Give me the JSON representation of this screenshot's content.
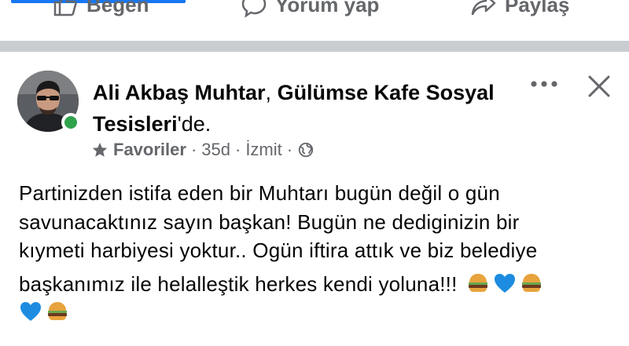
{
  "actions": {
    "like_label": "Beğen",
    "comment_label": "Yorum yap",
    "share_label": "Paylaş"
  },
  "post": {
    "author": "Ali Akbaş Muhtar",
    "connector": ", ",
    "location": "Gülümse Kafe Sosyal Tesisleri",
    "location_suffix": "'de.",
    "meta": {
      "favorites_label": "Favoriler",
      "dot1": "·",
      "time": "35d",
      "dot2": "·",
      "place": "İzmit",
      "dot3": "·"
    },
    "body_lines": [
      "Partinizden istifa eden bir Muhtarı bugün değil o gün",
      "savunacaktınız sayın başkan! Bugün ne dediginizin bir",
      "kıymeti harbiyesi yoktur.. Ogün iftira attık ve biz belediye",
      "başkanımız ile helalleştik herkes kendi yoluna!!!"
    ],
    "emojis": [
      "hamburger",
      "blue-heart",
      "hamburger",
      "blue-heart",
      "hamburger"
    ]
  },
  "icons": {
    "like": "thumbs-up-icon",
    "comment": "comment-bubble-icon",
    "share": "share-arrow-icon",
    "more": "more-horizontal-icon",
    "close": "close-icon",
    "star": "star-icon",
    "globe": "globe-icon"
  },
  "colors": {
    "accent": "#1877f2",
    "online": "#31a24c",
    "secondary_text": "#65676b",
    "separator": "#c9ccd1"
  }
}
